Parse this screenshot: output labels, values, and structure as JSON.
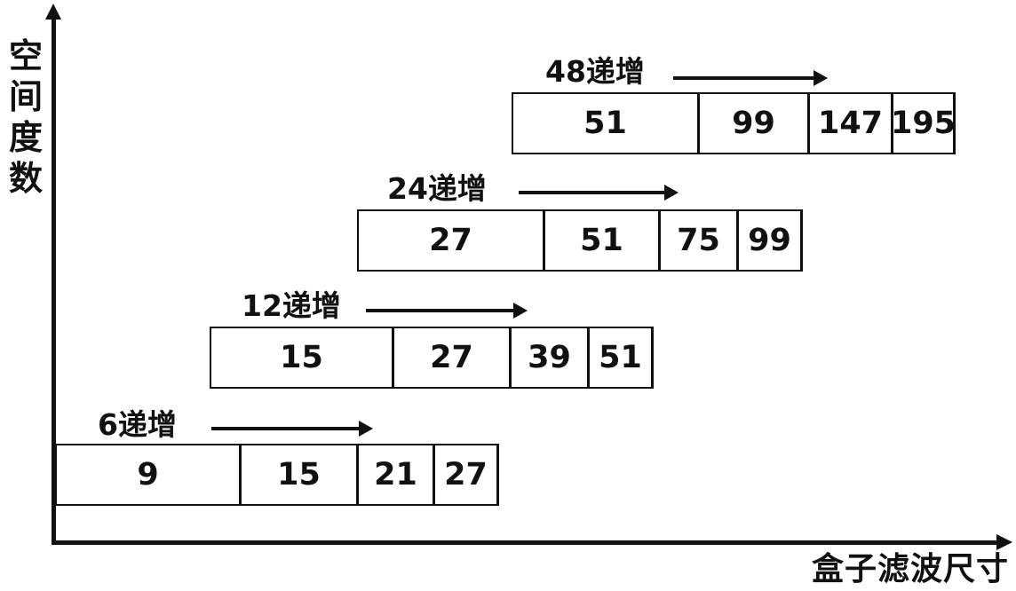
{
  "axes": {
    "y_label": "空间度数",
    "x_label": "盒子滤波尺寸"
  },
  "rows": [
    {
      "label": "6递增",
      "values": [
        "9",
        "15",
        "21",
        "27"
      ]
    },
    {
      "label": "12递增",
      "values": [
        "15",
        "27",
        "39",
        "51"
      ]
    },
    {
      "label": "24递增",
      "values": [
        "27",
        "51",
        "75",
        "99"
      ]
    },
    {
      "label": "48递增",
      "values": [
        "51",
        "99",
        "147",
        "195"
      ]
    }
  ]
}
